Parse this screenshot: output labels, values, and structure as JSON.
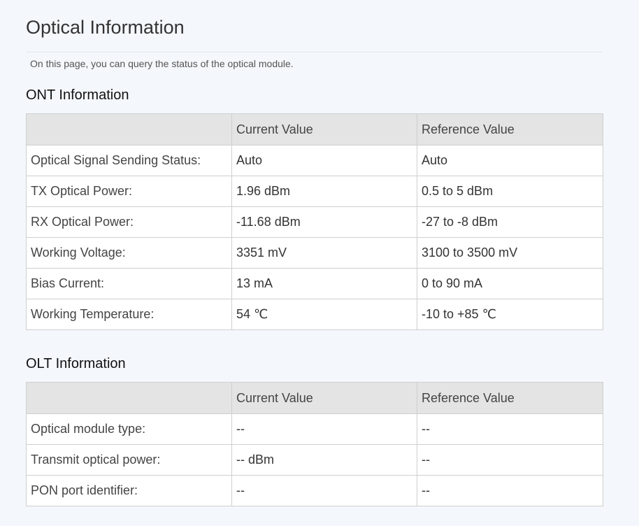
{
  "page": {
    "title": "Optical Information",
    "description": "On this page, you can query the status of the optical module."
  },
  "ont": {
    "title": "ONT Information",
    "headers": [
      "",
      "Current Value",
      "Reference Value"
    ],
    "rows": [
      {
        "label": "Optical Signal Sending Status:",
        "current": "Auto",
        "reference": "Auto"
      },
      {
        "label": "TX Optical Power:",
        "current": "1.96 dBm",
        "reference": "0.5 to 5 dBm"
      },
      {
        "label": "RX Optical Power:",
        "current": "-11.68 dBm",
        "reference": "-27 to -8 dBm"
      },
      {
        "label": "Working Voltage:",
        "current": "3351 mV",
        "reference": "3100 to 3500 mV"
      },
      {
        "label": "Bias Current:",
        "current": "13 mA",
        "reference": "0 to 90 mA"
      },
      {
        "label": "Working Temperature:",
        "current": "54 ℃",
        "reference": "-10 to +85 ℃"
      }
    ]
  },
  "olt": {
    "title": "OLT Information",
    "headers": [
      "",
      "Current Value",
      "Reference Value"
    ],
    "rows": [
      {
        "label": "Optical module type:",
        "current": "--",
        "reference": "--"
      },
      {
        "label": "Transmit optical power:",
        "current": "-- dBm",
        "reference": "--"
      },
      {
        "label": "PON port identifier:",
        "current": "--",
        "reference": "--"
      }
    ]
  }
}
